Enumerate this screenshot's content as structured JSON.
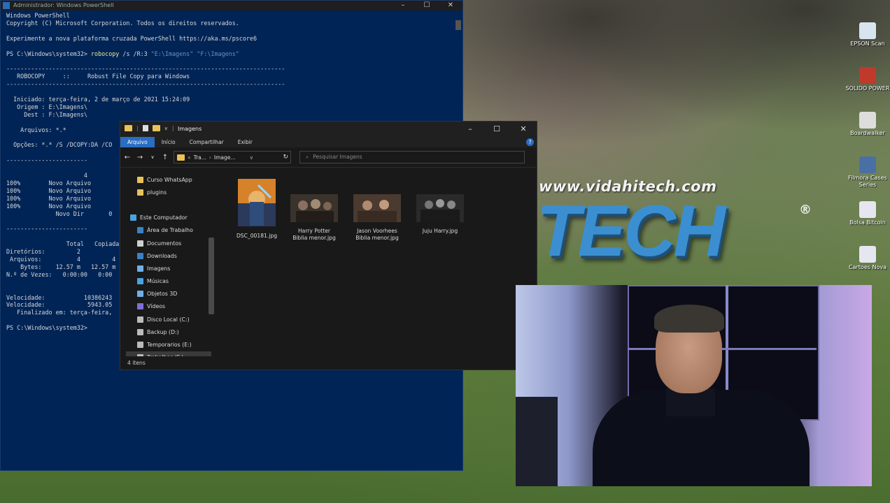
{
  "powershell": {
    "title": "Administrador: Windows PowerShell",
    "lines": [
      "Windows PowerShell",
      "Copyright (C) Microsoft Corporation. Todos os direitos reservados.",
      "",
      "Experimente a nova plataforma cruzada PowerShell https://aka.ms/pscore6",
      ""
    ],
    "prompt1": "PS C:\\Windows\\system32> ",
    "cmd": "robocopy",
    "cmd_args": " /s /R:3 ",
    "cmd_paths": "\"E:\\Imagens\" \"F:\\Imagens\"",
    "output": [
      "",
      "-------------------------------------------------------------------------------",
      "   ROBOCOPY     ::     Robust File Copy para Windows",
      "-------------------------------------------------------------------------------",
      "",
      "  Iniciado: terça-feira, 2 de março de 2021 15:24:09",
      "   Origem : E:\\Imagens\\",
      "     Dest : F:\\Imagens\\",
      "",
      "    Arquivos: *.*",
      "",
      "  Opções: *.* /S /DCOPY:DA /CO",
      "",
      "-----------------------",
      "",
      "                      4",
      "100%        Novo Arquivo",
      "100%        Novo Arquivo",
      "100%        Novo Arquivo",
      "100%        Novo Arquivo",
      "              Novo Dir       0",
      "",
      "-----------------------",
      "",
      "                 Total   Copiada",
      "Diretórios:         2",
      " Arquivos:          4         4",
      "    Bytes:    12.57 m   12.57 m",
      "N.º de Vezes:   0:00:00   0:00",
      "",
      "",
      "Velocidade:           10386243",
      "Velocidade:            5943.05",
      "   Finalizado em: terça-feira,",
      ""
    ],
    "prompt2": "PS C:\\Windows\\system32>"
  },
  "explorer": {
    "title": "Imagens",
    "tabs": [
      "Arquivo",
      "Início",
      "Compartilhar",
      "Exibir"
    ],
    "address": [
      "Tra...",
      "Image..."
    ],
    "search_placeholder": "Pesquisar Imagens",
    "sidebar": [
      {
        "label": "Curso WhatsApp",
        "icon": "folder-icon",
        "color": "#e8c15a",
        "indent": 1
      },
      {
        "label": "plugins",
        "icon": "folder-icon",
        "color": "#e8c15a",
        "indent": 1
      },
      {
        "label": "",
        "icon": "",
        "color": "",
        "indent": 1
      },
      {
        "label": "Este Computador",
        "icon": "computer-icon",
        "color": "#4aa3df",
        "indent": 0
      },
      {
        "label": "Área de Trabalho",
        "icon": "desktop-icon",
        "color": "#3b82c4",
        "indent": 1
      },
      {
        "label": "Documentos",
        "icon": "documents-icon",
        "color": "#cfcfcf",
        "indent": 1
      },
      {
        "label": "Downloads",
        "icon": "downloads-icon",
        "color": "#3b82c4",
        "indent": 1
      },
      {
        "label": "Imagens",
        "icon": "images-icon",
        "color": "#6fb0e6",
        "indent": 1
      },
      {
        "label": "Músicas",
        "icon": "music-icon",
        "color": "#4aa3df",
        "indent": 1
      },
      {
        "label": "Objetos 3D",
        "icon": "3d-objects-icon",
        "color": "#6fb0e6",
        "indent": 1
      },
      {
        "label": "Vídeos",
        "icon": "videos-icon",
        "color": "#7d6fd6",
        "indent": 1
      },
      {
        "label": "Disco Local (C:)",
        "icon": "drive-icon",
        "color": "#bbbbbb",
        "indent": 1
      },
      {
        "label": "Backup (D:)",
        "icon": "drive-icon",
        "color": "#bbbbbb",
        "indent": 1
      },
      {
        "label": "Temporarios (E:)",
        "icon": "drive-icon",
        "color": "#bbbbbb",
        "indent": 1
      },
      {
        "label": "Trabalhos (F:)",
        "icon": "drive-icon",
        "color": "#bbbbbb",
        "indent": 1
      }
    ],
    "files": [
      {
        "name1": "DSC_00181.jpg",
        "name2": ""
      },
      {
        "name1": "Harry Potter",
        "name2": "Biblia menor.jpg"
      },
      {
        "name1": "Jason Voorhees",
        "name2": "Biblia menor.jpg"
      },
      {
        "name1": "Juju Harry.jpg",
        "name2": ""
      }
    ],
    "status": "4 itens"
  },
  "wallpaper": {
    "url": "www.vidahitech.com",
    "logo": "TECH",
    "reg": "®"
  },
  "desktop_icons": [
    {
      "label": "EPSON Scan",
      "color": "#d8e4f0"
    },
    {
      "label": "SOLIDO POWER",
      "color": "#c0392b"
    },
    {
      "label": "Boardwalker",
      "color": "#dddddd"
    },
    {
      "label": "Filmora Cases Series",
      "color": "#4a6fa5"
    },
    {
      "label": "Bolsa Bitcoin",
      "color": "#e6e6f0"
    },
    {
      "label": "Cartoes Nova",
      "color": "#e6e6f0"
    }
  ]
}
